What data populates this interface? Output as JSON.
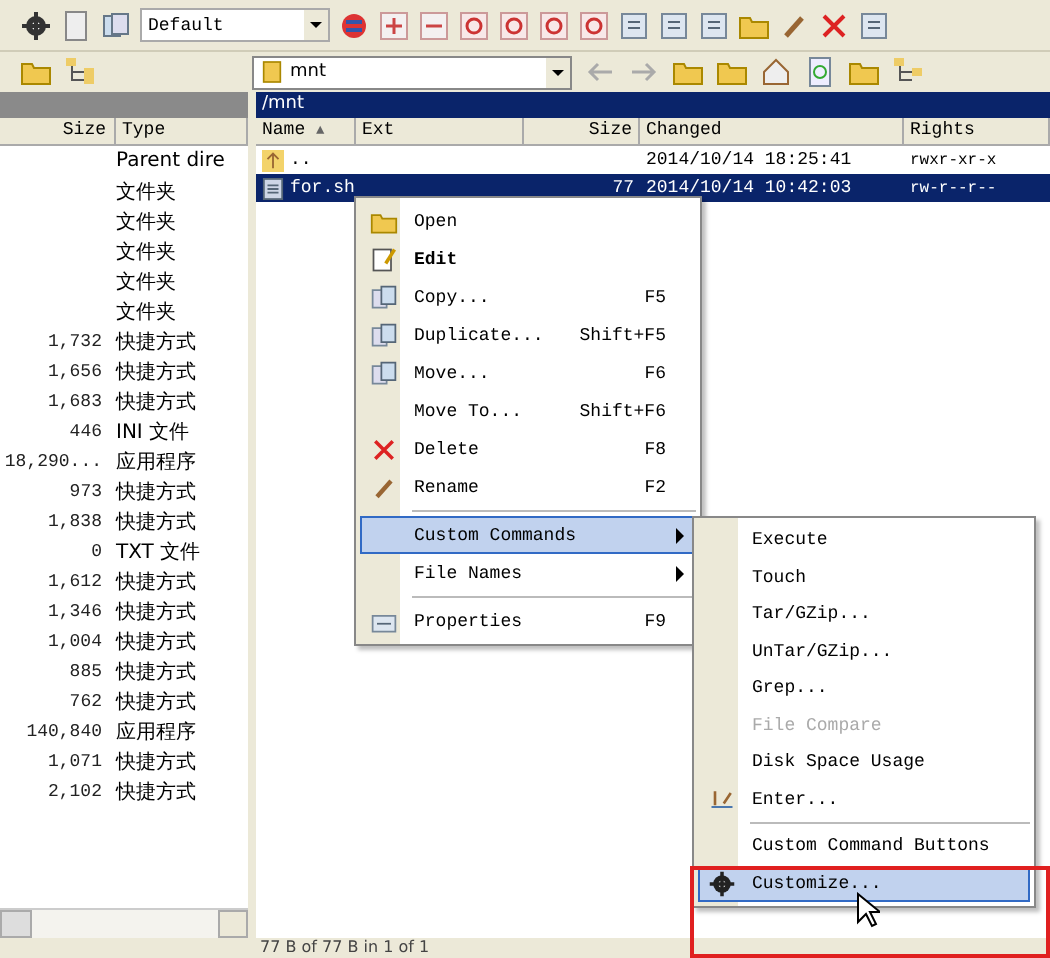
{
  "toolbar": {
    "profile": "Default",
    "location": "mnt"
  },
  "left_panel": {
    "columns": [
      "Size",
      "Type"
    ],
    "rows": [
      {
        "type": "Parent dire"
      },
      {
        "type": "文件夹"
      },
      {
        "type": "文件夹"
      },
      {
        "type": "文件夹"
      },
      {
        "type": "文件夹"
      },
      {
        "type": "文件夹"
      },
      {
        "size": "1,732",
        "type": "快捷方式"
      },
      {
        "size": "1,656",
        "type": "快捷方式"
      },
      {
        "size": "1,683",
        "type": "快捷方式"
      },
      {
        "size": "446",
        "type": "INI 文件"
      },
      {
        "size": "18,290...",
        "type": "应用程序"
      },
      {
        "size": "973",
        "type": "快捷方式"
      },
      {
        "size": "1,838",
        "type": "快捷方式"
      },
      {
        "size": "0",
        "type": "TXT 文件"
      },
      {
        "size": "1,612",
        "type": "快捷方式"
      },
      {
        "size": "1,346",
        "type": "快捷方式"
      },
      {
        "size": "1,004",
        "type": "快捷方式"
      },
      {
        "size": "885",
        "type": "快捷方式"
      },
      {
        "size": "762",
        "type": "快捷方式"
      },
      {
        "size": "140,840",
        "type": "应用程序"
      },
      {
        "size": "1,071",
        "type": "快捷方式"
      },
      {
        "size": "2,102",
        "type": "快捷方式"
      }
    ]
  },
  "right_panel": {
    "path": "/mnt",
    "columns": [
      "Name",
      "Ext",
      "Size",
      "Changed",
      "Rights"
    ],
    "sort_mark": "▲",
    "rows": [
      {
        "kind": "parent",
        "name": "..",
        "changed": "2014/10/14 18:25:41",
        "rights": "rwxr-xr-x",
        "selected": false
      },
      {
        "kind": "file",
        "name": "for.sh",
        "size": "77",
        "changed": "2014/10/14 10:42:03",
        "rights": "rw-r--r--",
        "selected": true
      }
    ]
  },
  "context_menu": {
    "items": [
      {
        "kind": "item",
        "label": "Open",
        "default": false,
        "selected": false
      },
      {
        "kind": "item",
        "label": "Edit",
        "default": true,
        "selected": false
      },
      {
        "kind": "item",
        "label": "Copy...",
        "shortcut": "F5",
        "default": false,
        "selected": false
      },
      {
        "kind": "item",
        "label": "Duplicate...",
        "shortcut": "Shift+F5",
        "default": false,
        "selected": false
      },
      {
        "kind": "item",
        "label": "Move...",
        "shortcut": "F6",
        "default": false,
        "selected": false
      },
      {
        "kind": "item",
        "label": "Move To...",
        "shortcut": "Shift+F6",
        "default": false,
        "selected": false
      },
      {
        "kind": "item",
        "label": "Delete",
        "shortcut": "F8",
        "default": false,
        "selected": false
      },
      {
        "kind": "item",
        "label": "Rename",
        "shortcut": "F2",
        "default": false,
        "selected": false
      },
      {
        "kind": "separator"
      },
      {
        "kind": "submenu",
        "label": "Custom Commands",
        "default": false,
        "selected": true
      },
      {
        "kind": "submenu",
        "label": "File Names",
        "default": false,
        "selected": false
      },
      {
        "kind": "separator"
      },
      {
        "kind": "item",
        "label": "Properties",
        "shortcut": "F9",
        "default": false,
        "selected": false
      }
    ]
  },
  "submenu": {
    "items": [
      {
        "kind": "item",
        "label": "Execute",
        "disabled": false,
        "selected": false
      },
      {
        "kind": "item",
        "label": "Touch",
        "disabled": false,
        "selected": false
      },
      {
        "kind": "item",
        "label": "Tar/GZip...",
        "disabled": false,
        "selected": false
      },
      {
        "kind": "item",
        "label": "UnTar/GZip...",
        "disabled": false,
        "selected": false
      },
      {
        "kind": "item",
        "label": "Grep...",
        "disabled": false,
        "selected": false
      },
      {
        "kind": "item",
        "label": "File Compare",
        "disabled": true,
        "selected": false
      },
      {
        "kind": "item",
        "label": "Disk Space Usage",
        "disabled": false,
        "selected": false
      },
      {
        "kind": "item",
        "label": "Enter...",
        "disabled": false,
        "selected": false
      },
      {
        "kind": "separator"
      },
      {
        "kind": "item",
        "label": "Custom Command Buttons",
        "disabled": false,
        "selected": false
      },
      {
        "kind": "item",
        "label": "Customize...",
        "disabled": false,
        "selected": true
      }
    ]
  },
  "status_bar": {
    "text": "77 B of 77 B in 1 of 1"
  }
}
